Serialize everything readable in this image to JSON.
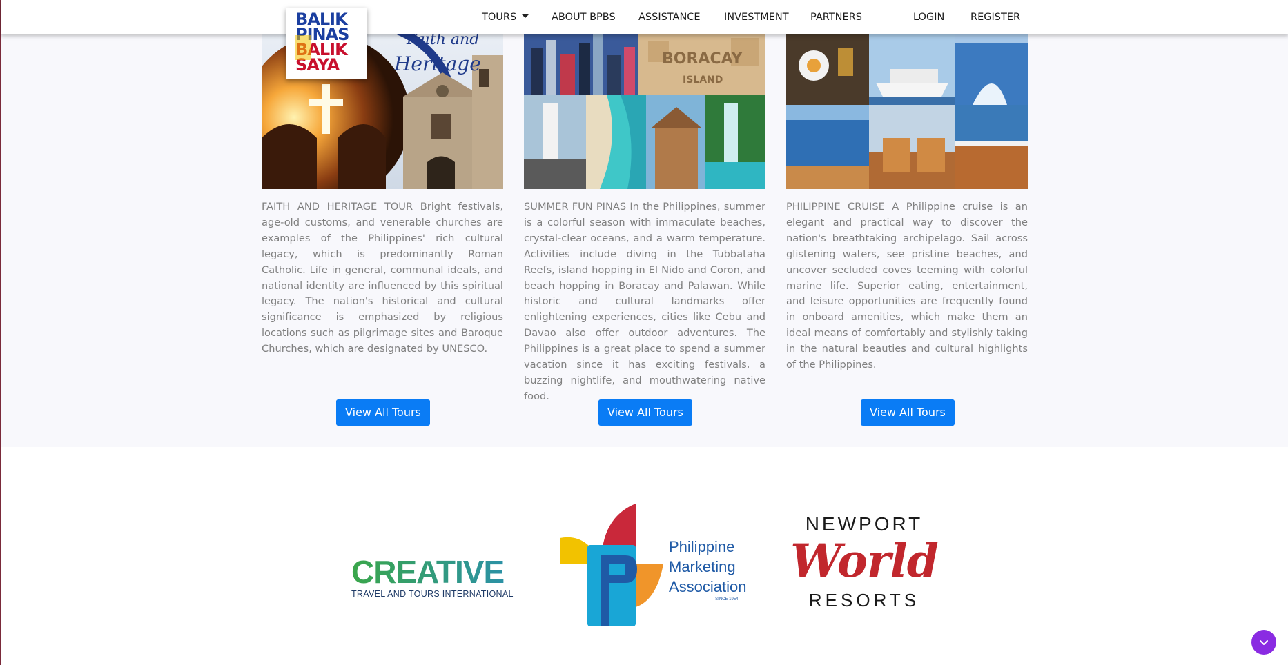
{
  "nav": {
    "items": [
      "TOURS",
      "ABOUT BPBS",
      "ASSISTANCE",
      "INVESTMENT",
      "PARTNERS",
      "LOGIN",
      "REGISTER"
    ],
    "logo_lines": [
      "BALIK",
      "PINAS",
      "BALIK",
      "SAYA"
    ]
  },
  "tours": [
    {
      "image_caption": "Faith and Heritage",
      "text": "FAITH AND HERITAGE TOUR Bright festivals, age-old customs, and venerable churches are examples of the Philippines' rich cultural legacy, which is predominantly Roman Catholic. Life in general, communal ideals, and national identity are influenced by this spiritual legacy. The nation's historical and cultural significance is emphasized by religious locations such as pilgrimage sites and Baroque Churches, which are designated by UNESCO.",
      "button": "View All Tours"
    },
    {
      "image_caption": "BORACAY ISLAND",
      "text": "SUMMER FUN PINAS In the Philippines, summer is a colorful season with immaculate beaches, crystal-clear oceans, and a warm temperature. Activities include diving in the Tubbataha Reefs, island hopping in El Nido and Coron, and beach hopping in Boracay and Palawan. While historic and cultural landmarks offer enlightening experiences, cities like Cebu and Davao also offer outdoor adventures. The Philippines is a great place to spend a summer vacation since it has exciting festivals, a buzzing nightlife, and mouthwatering native food.",
      "button": "View All Tours"
    },
    {
      "image_caption": "",
      "text": "PHILIPPINE CRUISE A Philippine cruise is an elegant and practical way to discover the nation's breathtaking archipelago. Sail across glistening waters, see pristine beaches, and uncover secluded coves teeming with colorful marine life. Superior eating, entertainment, and leisure opportunities are frequently found in onboard amenities, which make them an ideal means of comfortably and stylishly taking in the natural beauties and cultural highlights of the Philippines.",
      "button": "View All Tours"
    }
  ],
  "sponsors": {
    "creative": {
      "name": "CREATIVE",
      "tagline": "TRAVEL AND TOURS INTERNATIONAL"
    },
    "pma": {
      "line1": "Philippine",
      "line2": "Marketing",
      "line3": "Association",
      "since": "SINCE 1954"
    },
    "newport": {
      "top": "NEWPORT",
      "middle": "World",
      "bottom": "RESORTS"
    }
  },
  "colors": {
    "button": "#0a7cf5",
    "scroll_button": "#8a2be2",
    "section_bg": "#f8f8fc"
  },
  "icons": {
    "scroll": "chevron-down-icon",
    "dropdown": "caret-down-icon"
  }
}
